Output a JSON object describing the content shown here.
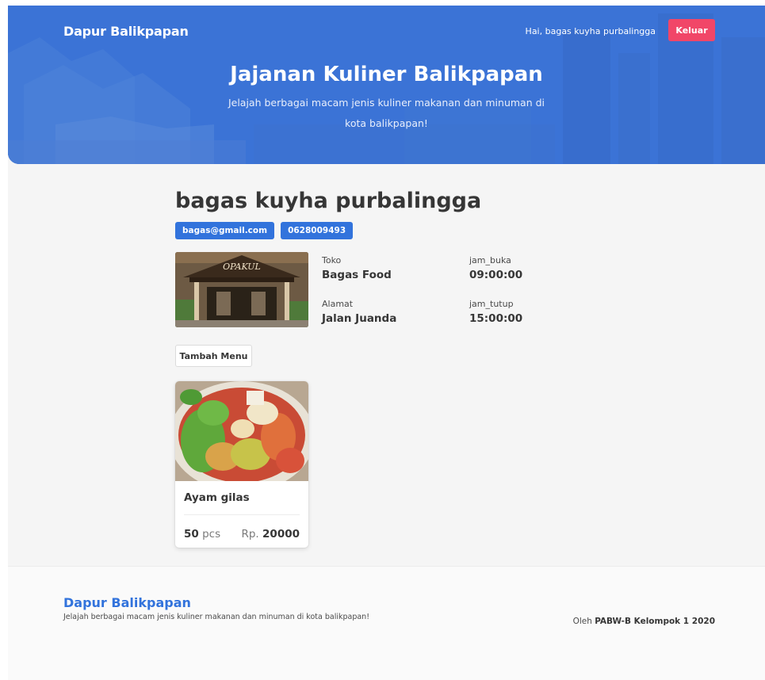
{
  "header": {
    "brand": "Dapur Balikpapan",
    "greeting": "Hai, bagas kuyha purbalingga",
    "logout_label": "Keluar",
    "title": "Jajanan Kuliner Balikpapan",
    "subtitle": "Jelajah berbagai macam jenis kuliner makanan dan minuman di kota balikpapan!"
  },
  "profile": {
    "name": "bagas kuyha purbalingga",
    "email": "bagas@gmail.com",
    "phone": "0628009493",
    "store_label": "Toko",
    "store": "Bagas Food",
    "address_label": "Alamat",
    "address": "Jalan Juanda",
    "open_label": "jam_buka",
    "open": "09:00:00",
    "close_label": "jam_tutup",
    "close": "15:00:00",
    "store_sign": "OPAKUL"
  },
  "actions": {
    "add_menu_label": "Tambah Menu"
  },
  "menu_items": [
    {
      "name": "Ayam gilas",
      "qty": "50",
      "qty_unit": "pcs",
      "price_prefix": "Rp.",
      "price": "20000"
    }
  ],
  "footer": {
    "brand": "Dapur Balikpapan",
    "description": "Jelajah berbagai macam jenis kuliner makanan dan minuman di kota balikpapan!",
    "credit_prefix": "Oleh",
    "credit": "PABW-B Kelompok 1 2020"
  },
  "colors": {
    "primary": "#3273dc",
    "danger": "#f14668",
    "hero": "#3b73d6"
  }
}
